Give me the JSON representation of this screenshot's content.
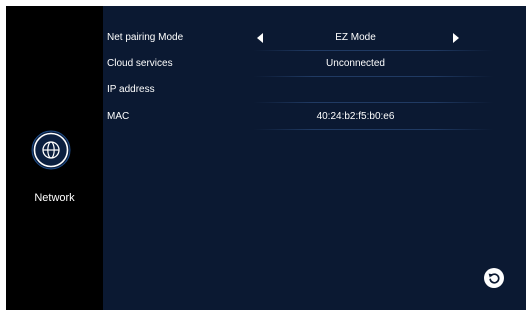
{
  "sidebar": {
    "icon": "globe-icon",
    "label": "Network"
  },
  "settings": [
    {
      "label": "Net pairing Mode",
      "value": "EZ Mode",
      "selector": true
    },
    {
      "label": "Cloud services",
      "value": "Unconnected"
    },
    {
      "label": "IP address",
      "value": ""
    },
    {
      "label": "MAC",
      "value": "40:24:b2:f5:b0:e6"
    }
  ],
  "back_button": {
    "icon": "back-icon"
  },
  "colors": {
    "background": "#0b1932",
    "sidebar": "#000000",
    "text": "#ffffff",
    "divider": "#203a63"
  }
}
